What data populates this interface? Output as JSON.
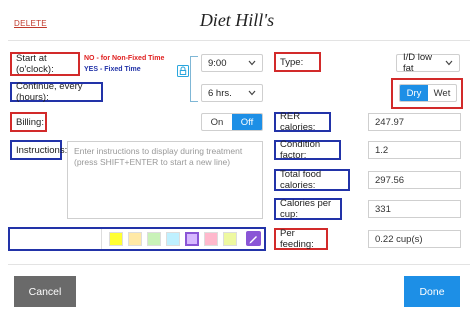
{
  "header": {
    "delete_label": "DELETE",
    "title": "Diet Hill's"
  },
  "left": {
    "start_label": "Start at (o'clock):",
    "note_non_fixed": "NO - for Non-Fixed Time",
    "note_fixed": "YES - Fixed Time",
    "start_value": "9:00",
    "continue_label": "Continue, every (hours):",
    "continue_value": "6 hrs.",
    "billing_label": "Billing:",
    "billing_on": "On",
    "billing_off": "Off",
    "billing_selected": "Off",
    "instructions_label": "Instructions:",
    "instructions_placeholder": "Enter instructions to display during treatment (press SHIFT+ENTER to start a new line)",
    "colors": [
      "#ffff33",
      "#ffe9a6",
      "#c9f2b8",
      "#bff0ff",
      "#d7b8ff",
      "#ffb8cc",
      "#eef8a0"
    ],
    "selected_color_index": 4
  },
  "right": {
    "type_label": "Type:",
    "type_value": "I/D low fat",
    "dry_label": "Dry",
    "wet_label": "Wet",
    "dry_wet_selected": "Dry",
    "rer_label": "RER calories:",
    "rer_value": "247.97",
    "condition_label": "Condition factor:",
    "condition_value": "1.2",
    "total_label": "Total food calories:",
    "total_value": "297.56",
    "per_cup_label": "Calories per cup:",
    "per_cup_value": "331",
    "per_feeding_label": "Per feeding:",
    "per_feeding_value": "0.22 cup(s)"
  },
  "footer": {
    "cancel_label": "Cancel",
    "done_label": "Done"
  },
  "colors": {
    "accent": "#1d8fe6",
    "red_box": "#d22a2a",
    "blue_box": "#2233a8",
    "cancel_bg": "#6a6a6a"
  }
}
